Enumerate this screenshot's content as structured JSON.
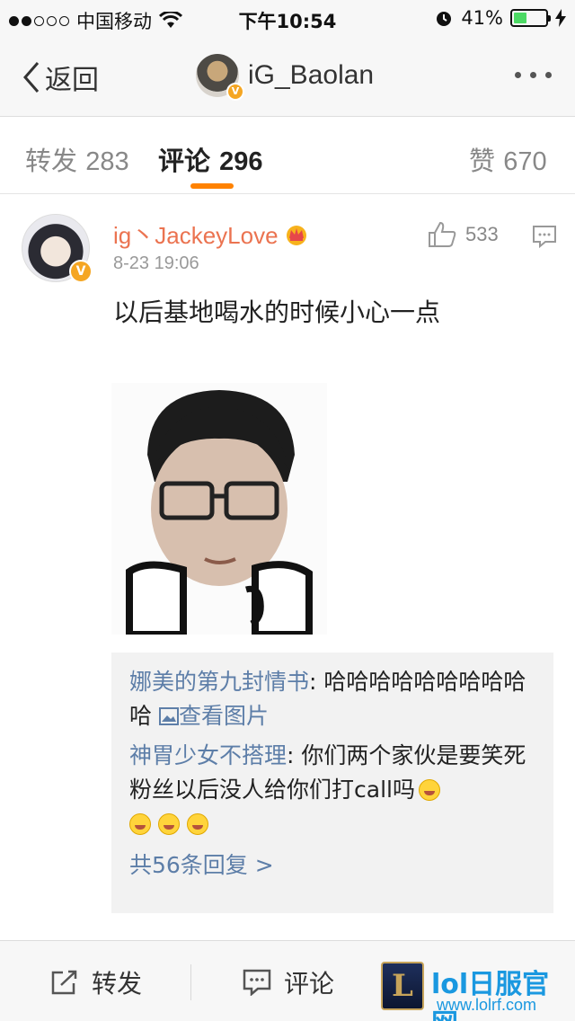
{
  "status_bar": {
    "carrier": "中国移动",
    "time": "下午10:54",
    "battery": "41%",
    "battery_level": 0.41,
    "icons": [
      "signal-dots-icon",
      "wifi-icon",
      "alarm-icon",
      "battery-icon",
      "charging-icon"
    ]
  },
  "nav": {
    "back_label": "返回",
    "title": "iG_Baolan",
    "icons": [
      "chevron-left-icon",
      "more-icon",
      "verified-badge-icon"
    ]
  },
  "tabs": [
    {
      "label": "转发",
      "count": "283",
      "active": false
    },
    {
      "label": "评论",
      "count": "296",
      "active": true
    },
    {
      "label": "赞",
      "count": "670",
      "active": false
    }
  ],
  "comment": {
    "author": "ig丶JackeyLove",
    "date": "8-23 19:06",
    "likes": "533",
    "text": "以后基地喝水的时候小心一点",
    "verified_badge": "V",
    "icons": [
      "crown-icon",
      "thumbs-up-icon",
      "reply-icon"
    ],
    "replies": [
      {
        "name": "娜美的第九封情书",
        "text": ": 哈哈哈哈哈哈哈哈哈哈",
        "link": "查看图片",
        "link_icon": "image-icon"
      },
      {
        "name": "神胃少女不搭理",
        "text": ": 你们两个家伙是要笑死粉丝以后没人给你们打call吗",
        "emoji": "laughing-tears-icon",
        "emoji_count": 4
      }
    ],
    "more_replies": "共56条回复 >"
  },
  "bottom_bar": {
    "repost_label": "转发",
    "comment_label": "评论",
    "icons": [
      "share-icon",
      "comment-icon"
    ]
  },
  "watermark": {
    "logo_letter": "L",
    "title": "lol日服官网",
    "url": "www.lolrf.com"
  },
  "colors": {
    "accent": "#ff8200",
    "author": "#eb7350",
    "link": "#5d7ea8",
    "watermark": "#1a98e0"
  }
}
